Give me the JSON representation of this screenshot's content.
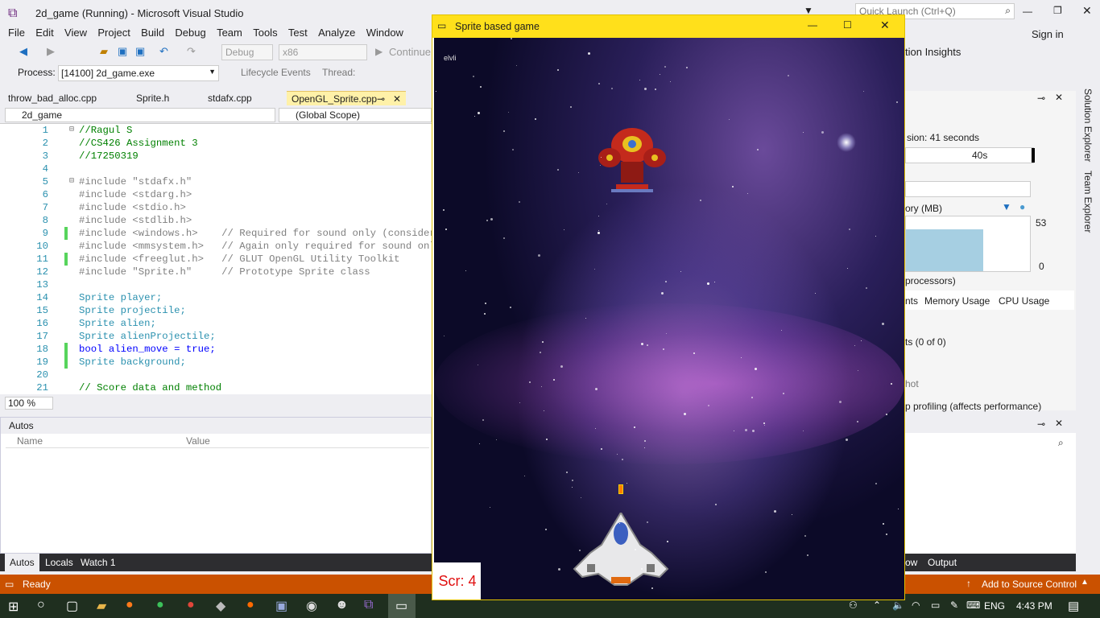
{
  "window": {
    "title": "2d_game (Running) - Microsoft Visual Studio",
    "quick_launch_placeholder": "Quick Launch (Ctrl+Q)",
    "sign_in": "Sign in"
  },
  "menu": [
    "File",
    "Edit",
    "View",
    "Project",
    "Build",
    "Debug",
    "Team",
    "Tools",
    "Test",
    "Analyze",
    "Window"
  ],
  "toolbar": {
    "config": "Debug",
    "platform": "x86",
    "continue": "Continue",
    "app_insights": "tion Insights"
  },
  "process_bar": {
    "label": "Process:",
    "process": "[14100] 2d_game.exe",
    "lifecycle": "Lifecycle Events",
    "thread": "Thread:"
  },
  "tabs": [
    "throw_bad_alloc.cpp",
    "Sprite.h",
    "stdafx.cpp",
    "OpenGL_Sprite.cpp"
  ],
  "scope": {
    "project": "2d_game",
    "scope": "(Global Scope)"
  },
  "code_lines": [
    {
      "n": "1",
      "t": "//Ragul S"
    },
    {
      "n": "2",
      "t": "//CS426 Assignment 3"
    },
    {
      "n": "3",
      "t": "//17250319"
    },
    {
      "n": "4",
      "t": ""
    },
    {
      "n": "5",
      "t": "#include \"stdafx.h\""
    },
    {
      "n": "6",
      "t": "#include <stdarg.h>"
    },
    {
      "n": "7",
      "t": "#include <stdio.h>"
    },
    {
      "n": "8",
      "t": "#include <stdlib.h>"
    },
    {
      "n": "9",
      "t": "#include <windows.h>    // Required for sound only (consider Op"
    },
    {
      "n": "10",
      "t": "#include <mmsystem.h>   // Again only required for sound only"
    },
    {
      "n": "11",
      "t": "#include <freeglut.h>   // GLUT OpenGL Utility Toolkit"
    },
    {
      "n": "12",
      "t": "#include \"Sprite.h\"     // Prototype Sprite class"
    },
    {
      "n": "13",
      "t": ""
    },
    {
      "n": "14",
      "t": "Sprite player;"
    },
    {
      "n": "15",
      "t": "Sprite projectile;"
    },
    {
      "n": "16",
      "t": "Sprite alien;"
    },
    {
      "n": "17",
      "t": "Sprite alienProjectile;"
    },
    {
      "n": "18",
      "t": "bool alien_move = true;"
    },
    {
      "n": "19",
      "t": "Sprite background;"
    },
    {
      "n": "20",
      "t": ""
    },
    {
      "n": "21",
      "t": "// Score data and method"
    }
  ],
  "zoom": "100 %",
  "autos": {
    "title": "Autos",
    "col_name": "Name",
    "col_value": "Value"
  },
  "bottom_tabs": [
    "Autos",
    "Locals",
    "Watch 1"
  ],
  "status": {
    "ready": "Ready",
    "source_control": "Add to Source Control"
  },
  "game": {
    "title": "Sprite based game",
    "score": "Scr: 4",
    "corner_text": "elvli"
  },
  "diag": {
    "session": "sion: 41 seconds",
    "time_label": "40s",
    "memory": "ory (MB)",
    "mem_max": "53",
    "mem_min": "0",
    "processors": "processors)",
    "tab_events": "nts",
    "tab_memory": "Memory Usage",
    "tab_cpu": "CPU Usage",
    "events_count": "ts (0 of 0)",
    "snapshot": "hot",
    "profiling": "p profiling (affects performance)"
  },
  "output_tabs": [
    "ow",
    "Output"
  ],
  "side_tabs": [
    "Solution Explorer",
    "Team Explorer"
  ],
  "taskbar": {
    "lang": "ENG",
    "time": "4:43 PM"
  }
}
